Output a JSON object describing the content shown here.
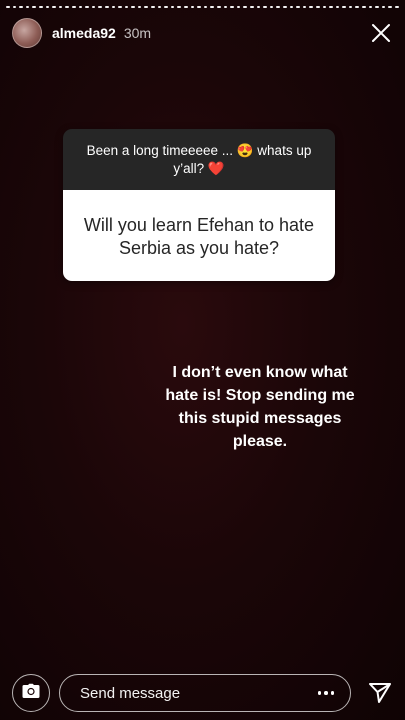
{
  "story": {
    "username": "almeda92",
    "time_ago": "30m",
    "progress_segment_count": 60
  },
  "question_card": {
    "prompt": "Been a long timeeeee ... 😍 whats up y’all? ❤️",
    "question": "Will you learn Efehan to hate Serbia as you hate?"
  },
  "reply_text": "I don’t even know what hate is! Stop sending me this stupid messages please.",
  "composer": {
    "placeholder": "Send message"
  },
  "icons": {
    "close": "close-icon",
    "camera": "camera-icon",
    "more": "more-icon",
    "send": "send-icon"
  }
}
